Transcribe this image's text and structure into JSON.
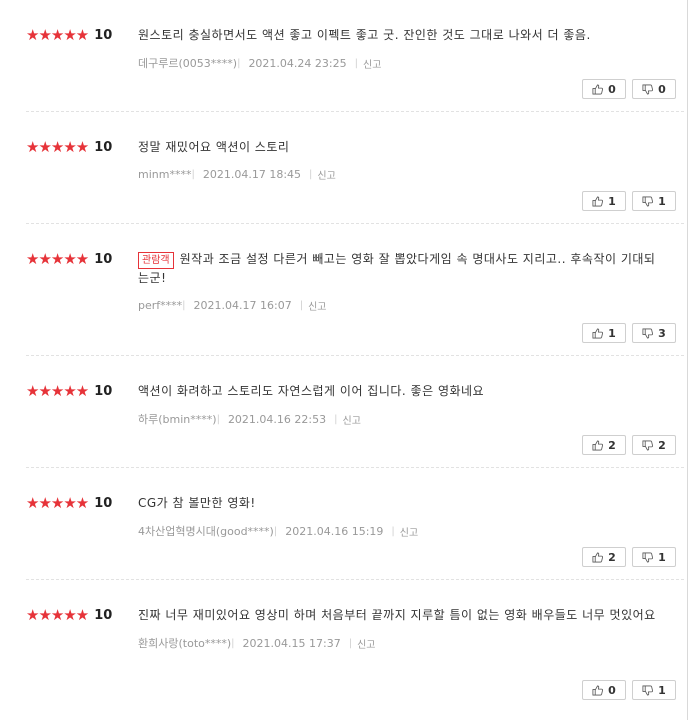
{
  "reviews": [
    {
      "stars": "★★★★★",
      "score": "10",
      "badge": "",
      "text": "원스토리 충실하면서도 액션 좋고 이펙트 좋고 굿. 잔인한 것도 그대로 나와서 더 좋음.",
      "author": "데구루르(0053****)",
      "date": "2021.04.24 23:25",
      "report": "신고",
      "likes": "0",
      "dislikes": "0"
    },
    {
      "stars": "★★★★★",
      "score": "10",
      "badge": "",
      "text": "정말 재밌어요 액션이 스토리",
      "author": "minm****",
      "date": "2021.04.17 18:45",
      "report": "신고",
      "likes": "1",
      "dislikes": "1"
    },
    {
      "stars": "★★★★★",
      "score": "10",
      "badge": "관람객",
      "text": "원작과 조금 설정 다른거 빼고는 영화 잘 뽑았다게임 속 명대사도 지리고.. 후속작이 기대되는군!",
      "author": "perf****",
      "date": "2021.04.17 16:07",
      "report": "신고",
      "likes": "1",
      "dislikes": "3"
    },
    {
      "stars": "★★★★★",
      "score": "10",
      "badge": "",
      "text": "액션이 화려하고 스토리도 자연스럽게 이어 집니다. 좋은 영화네요",
      "author": "하루(bmin****)",
      "date": "2021.04.16 22:53",
      "report": "신고",
      "likes": "2",
      "dislikes": "2"
    },
    {
      "stars": "★★★★★",
      "score": "10",
      "badge": "",
      "text": "CG가 참 볼만한 영화!",
      "author": "4차산업혁명시대(good****)",
      "date": "2021.04.16 15:19",
      "report": "신고",
      "likes": "2",
      "dislikes": "1"
    },
    {
      "stars": "★★★★★",
      "score": "10",
      "badge": "",
      "text": "진짜 너무 재미있어요 영상미 하며 처음부터 끝까지 지루할 틈이 없는 영화 배우들도 너무 멋있어요",
      "author": "환희사랑(toto****)",
      "date": "2021.04.15 17:37",
      "report": "신고",
      "likes": "0",
      "dislikes": "1"
    }
  ]
}
